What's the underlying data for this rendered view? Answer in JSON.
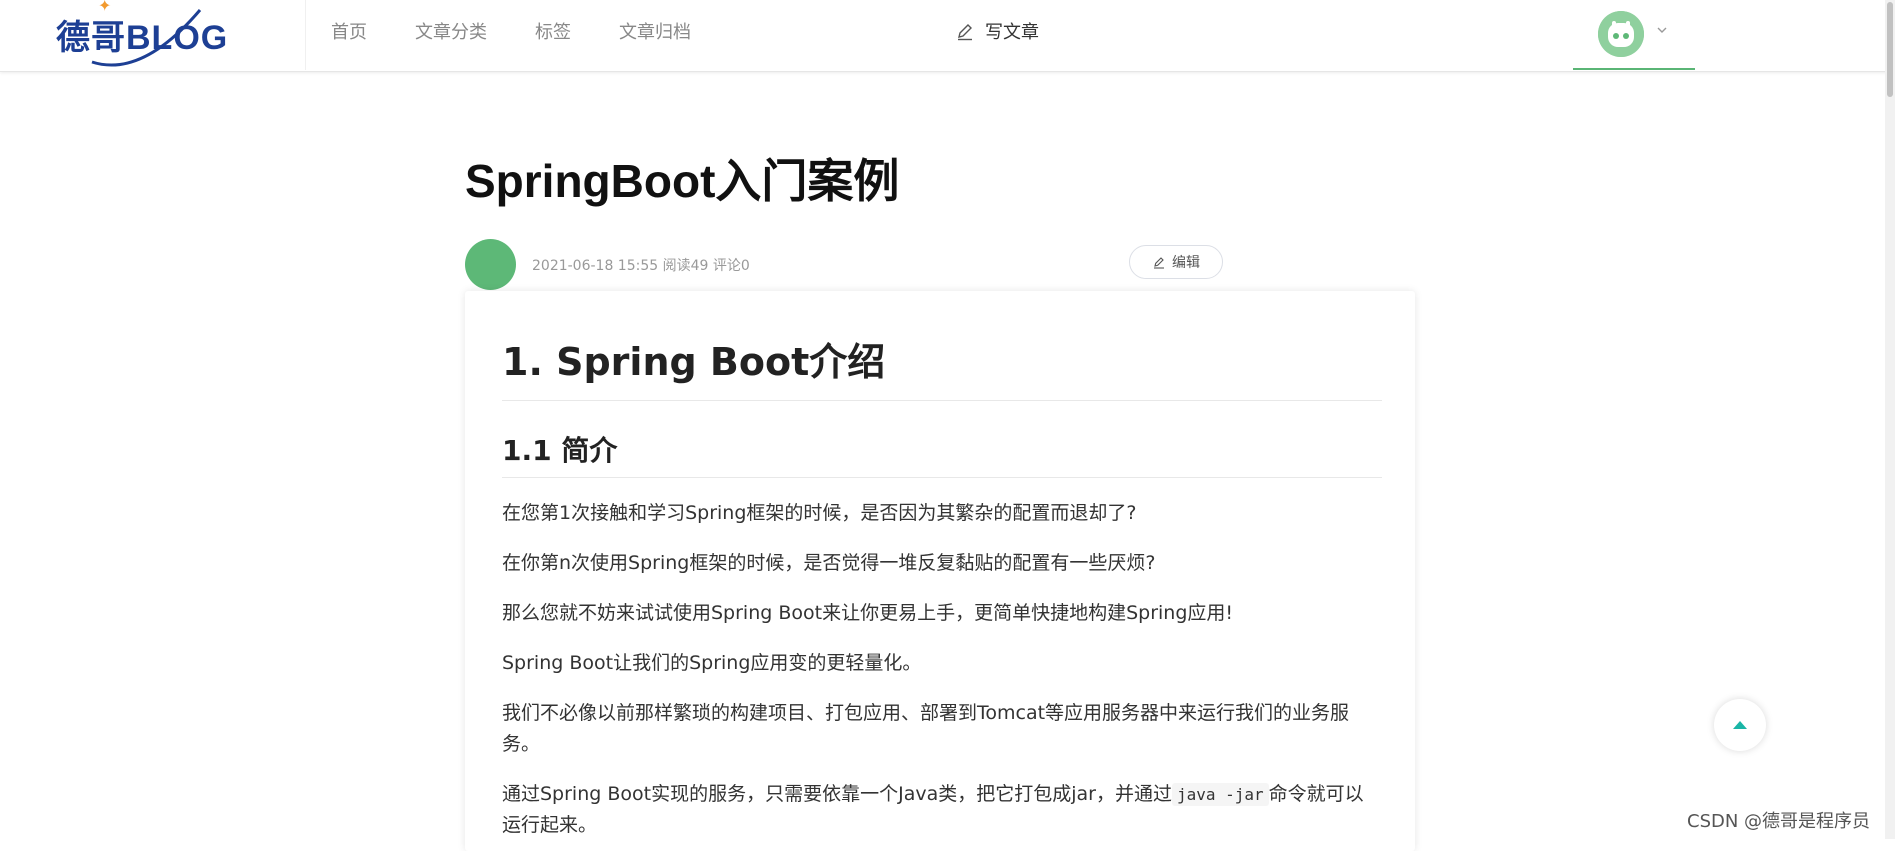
{
  "header": {
    "logo_text": "德哥BLOG",
    "nav": [
      "首页",
      "文章分类",
      "标签",
      "文章归档"
    ],
    "write_label": "写文章"
  },
  "article": {
    "title": "SpringBoot入门案例",
    "meta": "2021-06-18 15:55 阅读49 评论0",
    "edit_label": "编辑",
    "h1": "1. Spring Boot介绍",
    "h2": "1.1 简介",
    "paragraphs": [
      "在您第1次接触和学习Spring框架的时候，是否因为其繁杂的配置而退却了?",
      "在你第n次使用Spring框架的时候，是否觉得一堆反复黏贴的配置有一些厌烦?",
      "那么您就不妨来试试使用Spring Boot来让你更易上手，更简单快捷地构建Spring应用!",
      "Spring Boot让我们的Spring应用变的更轻量化。",
      "我们不必像以前那样繁琐的构建项目、打包应用、部署到Tomcat等应用服务器中来运行我们的业务服务。"
    ],
    "p6_before": "通过Spring Boot实现的服务，只需要依靠一个Java类，把它打包成jar，并通过",
    "p6_code": "java -jar",
    "p6_after": "命令就可以运行起来。"
  },
  "watermark": "CSDN @德哥是程序员",
  "icons": {
    "write": "pencil-icon",
    "edit": "pencil-icon",
    "dropdown": "chevron-down-icon",
    "back_top": "arrow-up-icon"
  },
  "colors": {
    "brand": "#1d3f94",
    "accent": "#5ab575",
    "back_top": "#1ab5a6"
  }
}
